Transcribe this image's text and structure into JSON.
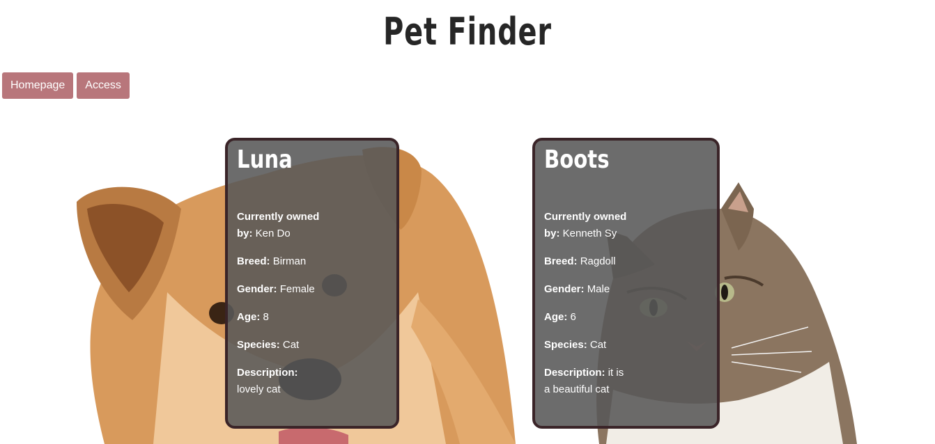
{
  "header": {
    "title": "Pet Finder"
  },
  "nav": {
    "homepage": "Homepage",
    "access": "Access"
  },
  "labels": {
    "owner": "Currently owned by:",
    "breed": "Breed:",
    "gender": "Gender:",
    "age": "Age:",
    "species": "Species:",
    "description": "Description:"
  },
  "pets": [
    {
      "name": "Luna",
      "owner": "Ken Do",
      "breed": "Birman",
      "gender": "Female",
      "age": "8",
      "species": "Cat",
      "description": "lovely cat"
    },
    {
      "name": "Boots",
      "owner": "Kenneth Sy",
      "breed": "Ragdoll",
      "gender": "Male",
      "age": "6",
      "species": "Cat",
      "description": "it is a beautiful cat"
    }
  ]
}
